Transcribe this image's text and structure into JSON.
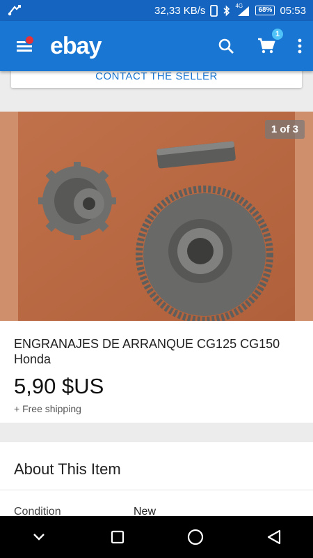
{
  "status_bar": {
    "speed": "32,33 KB/s",
    "network": "4G",
    "battery": "68%",
    "time": "05:53"
  },
  "app_bar": {
    "logo": "ebay",
    "cart_count": "1"
  },
  "contact_seller": {
    "label": "CONTACT THE SELLER"
  },
  "gallery": {
    "counter": "1 of 3"
  },
  "item": {
    "title": "ENGRANAJES DE ARRANQUE CG125 CG150 Honda",
    "price": "5,90 $US",
    "shipping": "+ Free shipping"
  },
  "about": {
    "heading": "About This Item",
    "condition_label": "Condition",
    "condition_value": "New"
  },
  "colors": {
    "app_bar": "#1976d2",
    "status_bar": "#1565c0",
    "notification_dot": "#e53238",
    "cart_badge": "#4fc3f7"
  }
}
